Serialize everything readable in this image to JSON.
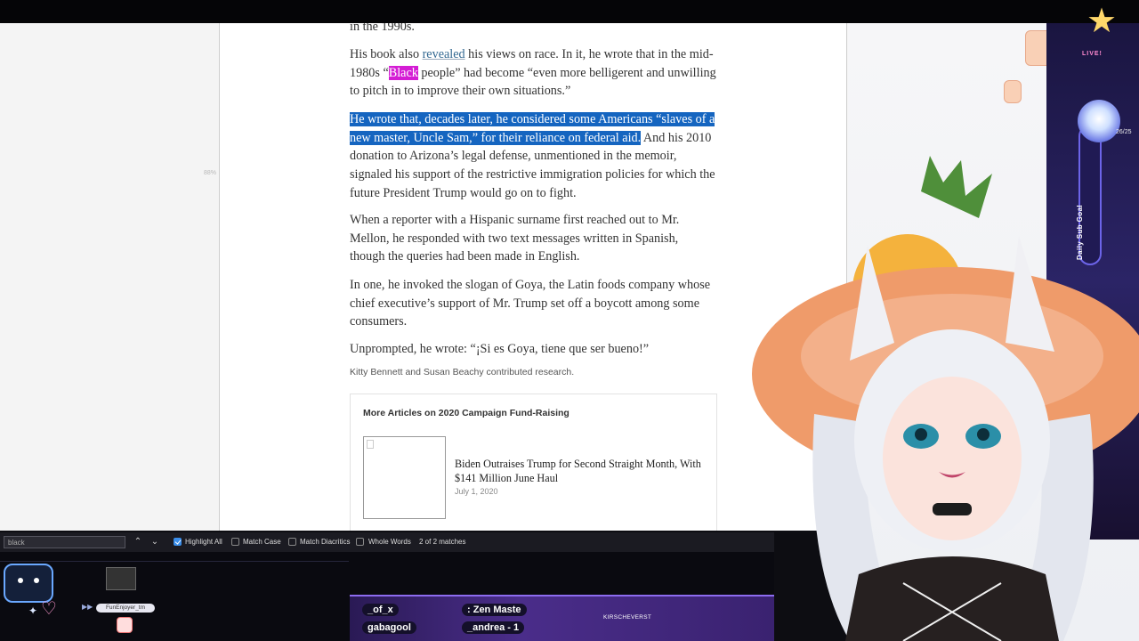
{
  "article": {
    "frag_top": "in the 1990s.",
    "p1_pre": "His book also ",
    "p1_link": "revealed",
    "p1_mid": " his views on race. In it, he wrote that in the mid-1980s “",
    "p1_highlight": "Black",
    "p1_post": " people” had become “even more belligerent and unwilling to pitch in to improve their own situations.”",
    "p2_selected": "He wrote that, decades later, he considered some Americans “slaves of a new master, Uncle Sam,” for their reliance on federal aid.",
    "p2_rest": " And his 2010 donation to Arizona’s legal defense, unmentioned in the memoir, signaled his support of the restrictive immigration policies for which the future President Trump would go on to fight.",
    "p3": "When a reporter with a Hispanic surname first reached out to Mr. Mellon, he responded with two text messages written in Spanish, though the queries had been made in English.",
    "p4": "In one, he invoked the slogan of Goya, the Latin foods company whose chief executive’s support of Mr. Trump set off a boycott among some consumers.",
    "p5": "Unprompted, he wrote: “¡Si es Goya, tiene que ser bueno!”",
    "credit": "Kitty Bennett and Susan Beachy contributed research."
  },
  "more_articles": {
    "title": "More Articles on 2020 Campaign Fund-Raising",
    "items": [
      {
        "headline": "Biden Outraises Trump for Second Straight Month, With $141 Million June Haul",
        "date": "July 1, 2020"
      }
    ]
  },
  "zoom_hint": "88%",
  "findbar": {
    "query": "black",
    "prev_icon": "chevron-up-icon",
    "next_icon": "chevron-down-icon",
    "highlight_all": {
      "label": "Highlight All",
      "checked": true
    },
    "match_case": {
      "label": "Match Case",
      "checked": false
    },
    "match_diacritics": {
      "label": "Match Diacritics",
      "checked": false
    },
    "whole_words": {
      "label": "Whole Words",
      "checked": false
    },
    "result": "2 of 2 matches"
  },
  "stream": {
    "live_label": "LIVE!",
    "goal_label": "Daily Sub Goal",
    "goal_count": "26/25",
    "chat_user": "FunEnjoyer_tm",
    "ticker": [
      "_of_x",
      ": Zen Maste",
      "gabagool",
      "_andrea - 1"
    ],
    "ticker_tag": "KIRSCHEVERST"
  },
  "colors": {
    "find_highlight": "#d41dd4",
    "selection": "#1565c0",
    "link": "#326891"
  }
}
